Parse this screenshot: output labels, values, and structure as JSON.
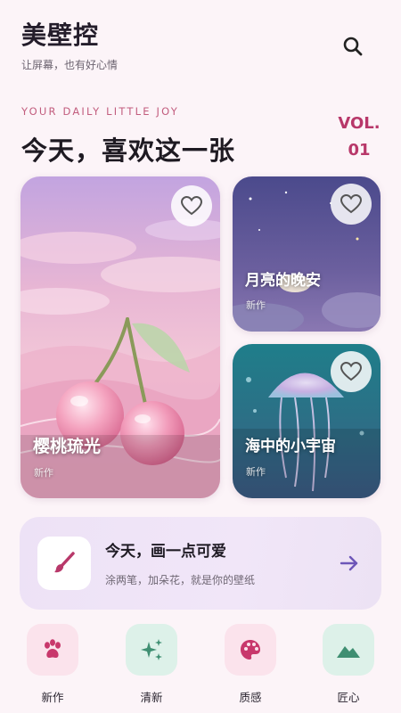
{
  "header": {
    "title": "美壁控",
    "subtitle": "让屏幕，也有好心情",
    "search_icon": "search-icon"
  },
  "hero": {
    "tagline": "YOUR DAILY LITTLE JOY",
    "headline": "今天，喜欢这一张",
    "vol_label": "VOL.",
    "vol_number": "01"
  },
  "cards": [
    {
      "title": "樱桃琉光",
      "tag": "新作",
      "favorited": false
    },
    {
      "title": "月亮的晚安",
      "tag": "新作",
      "favorited": false
    },
    {
      "title": "海中的小宇宙",
      "tag": "新作",
      "favorited": false
    }
  ],
  "banner": {
    "title": "今天，画一点可爱",
    "subtitle": "涂两笔，加朵花，就是你的壁纸",
    "icon": "brush-icon",
    "arrow_icon": "arrow-right-icon"
  },
  "categories": [
    {
      "label": "新作",
      "icon": "paw-icon",
      "bg": "#fbe3ec",
      "fg": "#c8386c"
    },
    {
      "label": "清新",
      "icon": "sparkle-icon",
      "bg": "#ddf1e9",
      "fg": "#3f8f72"
    },
    {
      "label": "质感",
      "icon": "palette-icon",
      "bg": "#fbe3ec",
      "fg": "#c8386c"
    },
    {
      "label": "匠心",
      "icon": "mountain-icon",
      "bg": "#ddf1e9",
      "fg": "#3f8f72"
    }
  ],
  "colors": {
    "accent": "#c25d7e",
    "background": "#fcf4f8",
    "banner": "#ede2f6"
  }
}
